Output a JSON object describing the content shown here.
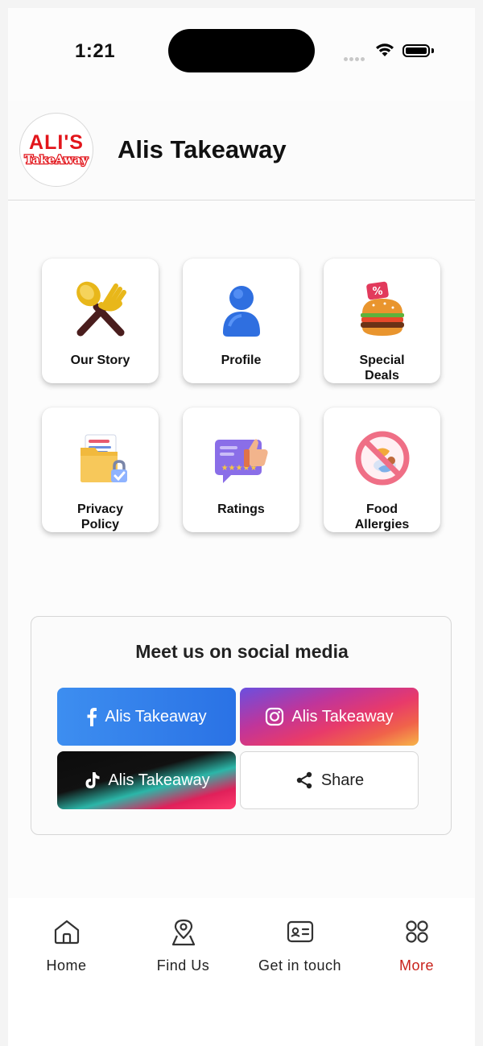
{
  "status": {
    "time": "1:21"
  },
  "header": {
    "logo_main": "ALI'S",
    "logo_sub": "TakeAway",
    "title": "Alis Takeaway"
  },
  "grid": [
    {
      "label_line1": "Our Story",
      "label_line2": "",
      "icon": "spoon-fork-icon"
    },
    {
      "label_line1": "Profile",
      "label_line2": "",
      "icon": "user-icon"
    },
    {
      "label_line1": "Special",
      "label_line2": "Deals",
      "icon": "burger-deal-icon"
    },
    {
      "label_line1": "Privacy",
      "label_line2": "Policy",
      "icon": "folder-lock-icon"
    },
    {
      "label_line1": "Ratings",
      "label_line2": "",
      "icon": "thumbs-up-rating-icon"
    },
    {
      "label_line1": "Food",
      "label_line2": "Allergies",
      "icon": "no-allergen-icon"
    }
  ],
  "social": {
    "title": "Meet us on social media",
    "facebook_label": "Alis Takeaway",
    "instagram_label": "Alis Takeaway",
    "tiktok_label": "Alis Takeaway",
    "share_label": "Share"
  },
  "nav": [
    {
      "label": "Home",
      "icon": "home-icon",
      "active": false
    },
    {
      "label": "Find Us",
      "icon": "location-pin-icon",
      "active": false
    },
    {
      "label": "Get in touch",
      "icon": "contact-card-icon",
      "active": false
    },
    {
      "label": "More",
      "icon": "grid-dots-icon",
      "active": true
    }
  ],
  "colors": {
    "accent": "#c8211b",
    "facebook": "#3d8ef0",
    "brand_red": "#e2151b"
  }
}
